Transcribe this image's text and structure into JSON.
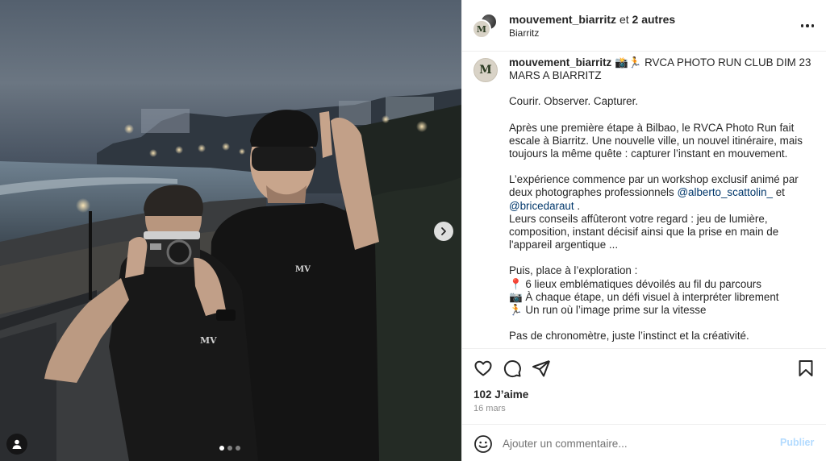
{
  "post": {
    "header": {
      "username": "mouvement_biarritz",
      "coauthors_text": "et 2 autres",
      "location": "Biarritz",
      "avatar_initial": "M"
    },
    "caption": {
      "username": "mouvement_biarritz",
      "title_emoji": "📸🏃",
      "title_line1": " RVCA PHOTO RUN CLUB DIM 23",
      "title_line2": "MARS A BIARRITZ",
      "tagline": "Courir. Observer. Capturer.",
      "p1_l1": "Après une première étape à Bilbao, le RVCA Photo Run fait",
      "p1_l2": "escale à Biarritz. Une nouvelle ville, un nouvel itinéraire, mais",
      "p1_l3": "toujours la même quête : capturer l’instant en mouvement.",
      "p2_l1": "L’expérience commence par un workshop exclusif animé par",
      "p2_l2_prefix": "deux photographes professionnels ",
      "mention1": "@alberto_scattolin_",
      "p2_l2_suffix": " et",
      "mention2": "@bricedaraut",
      "p2_l3_suffix": " .",
      "p3_l1": "Leurs conseils affûteront votre regard : jeu de lumière,",
      "p3_l2": "composition, instant décisif ainsi que la prise en main de",
      "p3_l3": "l'appareil argentique ...",
      "p4_l1": "Puis, place à l’exploration :",
      "bullet1": "📍 6 lieux emblématiques dévoilés au fil du parcours",
      "bullet2": "📷 À chaque étape, un défi visuel à interpréter librement",
      "bullet3": "🏃 Un run où l’image prime sur la vitesse",
      "p5_l1": "Pas de chronomètre, juste l’instinct et la créativité."
    },
    "likes": "102 J’aime",
    "date": "16 mars",
    "comment": {
      "placeholder": "Ajouter un commentaire...",
      "publish_label": "Publier"
    },
    "carousel": {
      "slides": 3,
      "active_slide": 1
    },
    "shirt_logo": "MV"
  },
  "icons": {
    "heart": "heart-icon",
    "comment": "comment-icon",
    "share": "share-icon",
    "save": "bookmark-icon",
    "emoji": "emoji-icon",
    "more": "more-icon",
    "next": "chevron-right-icon",
    "tag": "user-tag-icon"
  },
  "colors": {
    "mention": "#00376b",
    "publish_disabled": "#b3dbff",
    "muted": "#8e8e8e"
  }
}
